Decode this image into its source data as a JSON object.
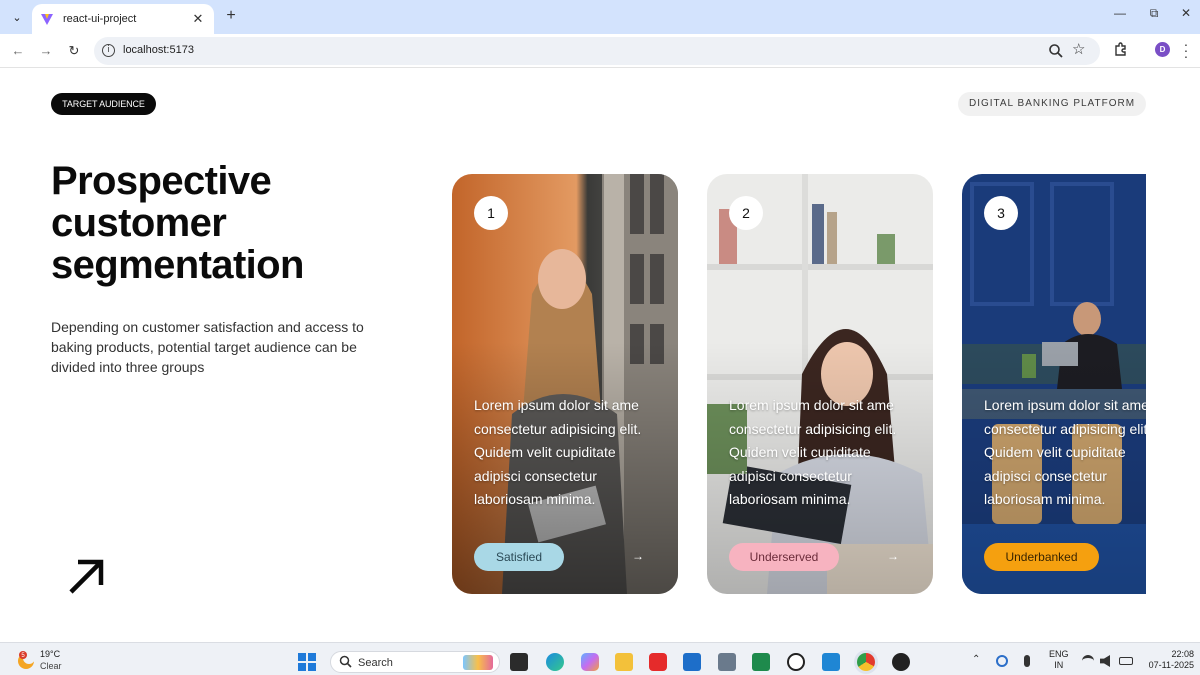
{
  "browser": {
    "tab_title": "react-ui-project",
    "new_tab_symbol": "+",
    "url": "localhost:5173",
    "profile_initial": "D"
  },
  "page": {
    "badge_left": "TARGET AUDIENCE",
    "badge_right": "DIGITAL BANKING PLATFORM",
    "title": "Prospective customer segmentation",
    "description": "Depending on customer satisfaction and access to baking products, potential target audience can be divided into three groups",
    "cards": [
      {
        "number": "1",
        "text": "Lorem ipsum dolor sit ame consectetur adipisicing elit. Quidem velit cupiditate adipisci consectetur laboriosam minima.",
        "tag": "Satisfied",
        "tag_color": "#a9d8e6",
        "tag_text_color": "#2b4a56"
      },
      {
        "number": "2",
        "text": "Lorem ipsum dolor sit ame consectetur adipisicing elit. Quidem velit cupiditate adipisci consectetur laboriosam minima.",
        "tag": "Underserved",
        "tag_color": "#f7b3c0",
        "tag_text_color": "#6b2c3a"
      },
      {
        "number": "3",
        "text": "Lorem ipsum dolor sit ame consectetur adipisicing elit. Quidem velit cupiditate adipisci consectetur laboriosam minima.",
        "tag": "Underbanked",
        "tag_color": "#f5a00f",
        "tag_text_color": "#3a2500"
      }
    ]
  },
  "taskbar": {
    "weather_temp": "19°C",
    "weather_condition": "Clear",
    "weather_badge": "5",
    "search_label": "Search",
    "lang_line1": "ENG",
    "lang_line2": "IN",
    "time": "22:08",
    "date": "07-11-2025"
  },
  "colors": {
    "accent_black": "#0a0a0a",
    "tabbar_bg": "#d3e3fd",
    "taskbar_bg": "#eef1f6"
  }
}
